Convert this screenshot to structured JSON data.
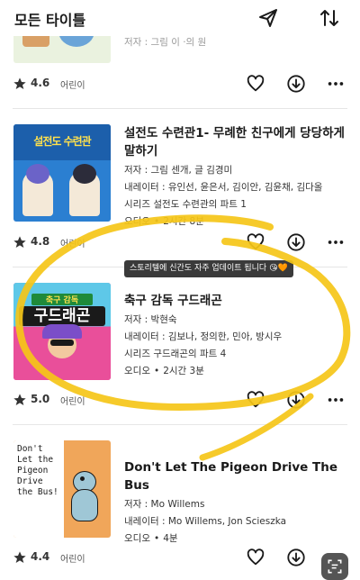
{
  "header": {
    "title": "모든 타이틀",
    "send_icon": "send-icon",
    "sort_icon": "sort-icon"
  },
  "top_partial": {
    "text": "저자 : 그림 이 ·의 원",
    "rating": "4.6",
    "genre": "어린이"
  },
  "items": [
    {
      "title": "설전도 수련관1- 무례한 친구에게 당당하게 말하기",
      "author_label": "저자 :",
      "author": "그림 센개, 글 김경미",
      "narrator_label": "내레이터 :",
      "narrator": "유인선, 윤은서, 김이안, 김윤채, 김다올",
      "series": "시리즈 설전도 수련관의 파트 1",
      "format": "오디오",
      "duration": "2시간 8분",
      "rating": "4.8",
      "genre": "어린이",
      "cover_text": "설전도 수련관",
      "cover_color": "#2b7fd1"
    },
    {
      "title": "축구 감독 구드래곤",
      "author_label": "저자 :",
      "author": "박현숙",
      "narrator_label": "내레이터 :",
      "narrator": "김보나, 정의한, 민아, 방시우",
      "series": "시리즈 구드래곤의 파트 4",
      "format": "오디오",
      "duration": "2시간 3분",
      "rating": "5.0",
      "genre": "어린이",
      "cover_text_top": "축구 감독",
      "cover_text": "구드래곤",
      "cover_color": "#e94f9a"
    },
    {
      "title": "Don't Let The Pigeon Drive The Bus",
      "author_label": "저자 :",
      "author": "Mo Willems",
      "narrator_label": "내레이터 :",
      "narrator": "Mo Willems, Jon Scieszka",
      "format": "오디오",
      "duration": "4분",
      "rating": "4.4",
      "genre": "어린이",
      "cover_text": "Don't Let the Pigeon Drive the Bus!",
      "cover_color": "#f0a65a"
    }
  ],
  "tooltip": "스토리텔에 신간도 자주 업데이트 됩니다 😘🧡",
  "icons": {
    "rating": "star-icon",
    "like": "heart-icon",
    "download": "download-icon",
    "more": "more-icon",
    "scan": "scan-icon"
  },
  "colors": {
    "highlight": "#f5c518",
    "tooltip_bg": "#3a3a3a"
  }
}
